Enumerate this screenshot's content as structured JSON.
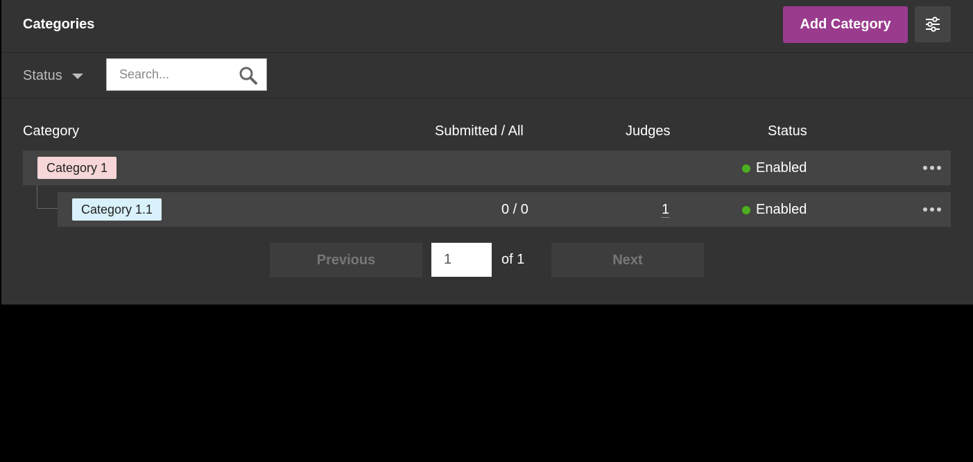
{
  "header": {
    "title": "Categories",
    "add_button_label": "Add Category",
    "settings_icon": "sliders-icon",
    "accent_color": "#9a3b8e"
  },
  "filters": {
    "status_label": "Status",
    "search_placeholder": "Search..."
  },
  "table": {
    "columns": [
      "Category",
      "Submitted / All",
      "Judges",
      "Status"
    ],
    "rows": [
      {
        "name": "Category 1",
        "submitted_all": "",
        "judges": "",
        "status": "Enabled",
        "level": 0
      },
      {
        "name": "Category 1.1",
        "submitted_all": "0 / 0",
        "judges": "1",
        "status": "Enabled",
        "level": 1
      }
    ],
    "status_color": "#4caf1f"
  },
  "pagination": {
    "previous_label": "Previous",
    "current_page": "1",
    "of_label": "of 1",
    "next_label": "Next"
  }
}
